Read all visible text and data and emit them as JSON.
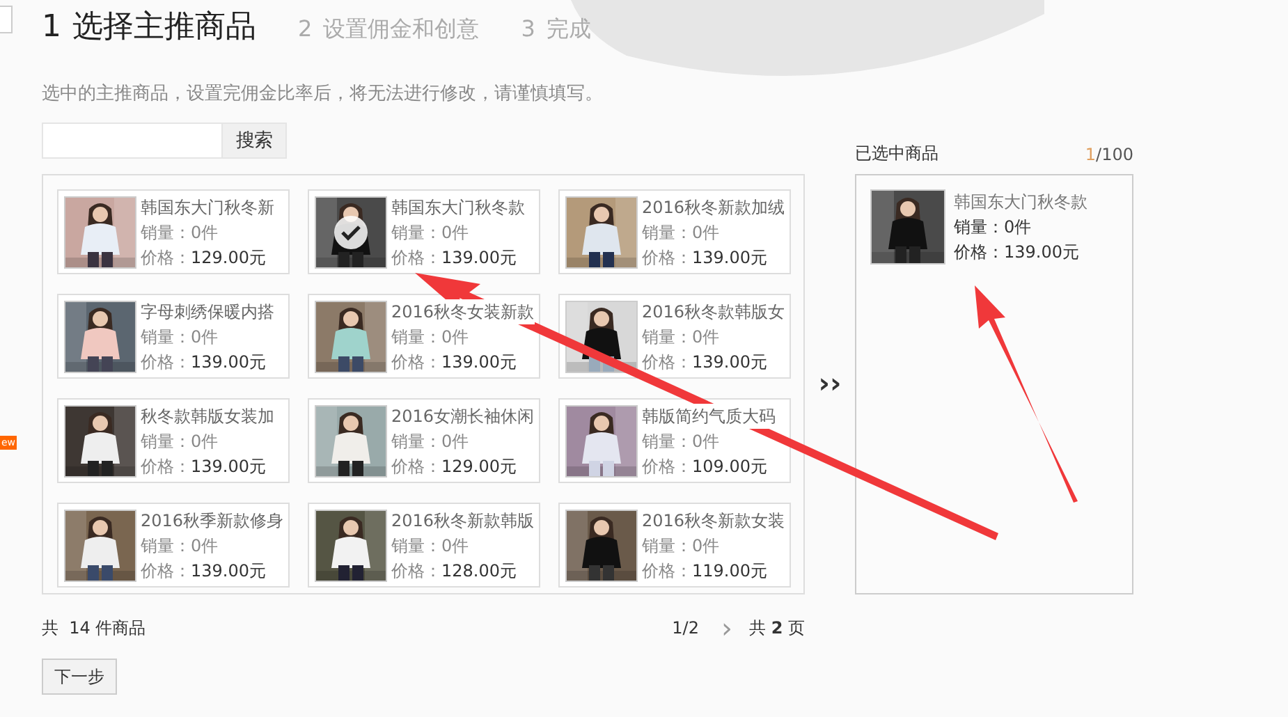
{
  "steps": [
    {
      "number": "1",
      "label": "选择主推商品",
      "selected": true
    },
    {
      "number": "2",
      "label": "设置佣金和创意",
      "selected": false
    },
    {
      "number": "3",
      "label": "完成",
      "selected": false
    }
  ],
  "hint": "选中的主推商品，设置完佣金比率后，将无法进行修改，请谨慎填写。",
  "search": {
    "button": "搜索"
  },
  "products": [
    {
      "title": "韩国东大门秋冬新",
      "sales": "销量：0件",
      "price_label": "价格：",
      "price": "129.00元",
      "selected": false
    },
    {
      "title": "韩国东大门秋冬款",
      "sales": "销量：0件",
      "price_label": "价格：",
      "price": "139.00元",
      "selected": true
    },
    {
      "title": "2016秋冬新款加绒",
      "sales": "销量：0件",
      "price_label": "价格：",
      "price": "139.00元",
      "selected": false
    },
    {
      "title": "字母刺绣保暖内搭",
      "sales": "销量：0件",
      "price_label": "价格：",
      "price": "139.00元",
      "selected": false
    },
    {
      "title": "2016秋冬女装新款",
      "sales": "销量：0件",
      "price_label": "价格：",
      "price": "139.00元",
      "selected": false
    },
    {
      "title": "2016秋冬款韩版女",
      "sales": "销量：0件",
      "price_label": "价格：",
      "price": "139.00元",
      "selected": false
    },
    {
      "title": "秋冬款韩版女装加",
      "sales": "销量：0件",
      "price_label": "价格：",
      "price": "139.00元",
      "selected": false
    },
    {
      "title": "2016女潮长袖休闲",
      "sales": "销量：0件",
      "price_label": "价格：",
      "price": "129.00元",
      "selected": false
    },
    {
      "title": "韩版简约气质大码",
      "sales": "销量：0件",
      "price_label": "价格：",
      "price": "109.00元",
      "selected": false
    },
    {
      "title": "2016秋季新款修身",
      "sales": "销量：0件",
      "price_label": "价格：",
      "price": "139.00元",
      "selected": false
    },
    {
      "title": "2016秋冬新款韩版",
      "sales": "销量：0件",
      "price_label": "价格：",
      "price": "128.00元",
      "selected": false
    },
    {
      "title": "2016秋冬新款女装",
      "sales": "销量：0件",
      "price_label": "价格：",
      "price": "119.00元",
      "selected": false
    }
  ],
  "move_button": "››",
  "selected_panel": {
    "title": "已选中商品",
    "count": "1",
    "limit": "/100",
    "items": [
      {
        "title": "韩国东大门秋冬款",
        "sales": "销量：0件",
        "price": "价格：139.00元"
      }
    ]
  },
  "footer": {
    "total": "共  14 件商品",
    "page": "1/2",
    "next": "›",
    "pages": "共 **2** 页"
  },
  "next_button": "下一步",
  "side_badge": "ew"
}
